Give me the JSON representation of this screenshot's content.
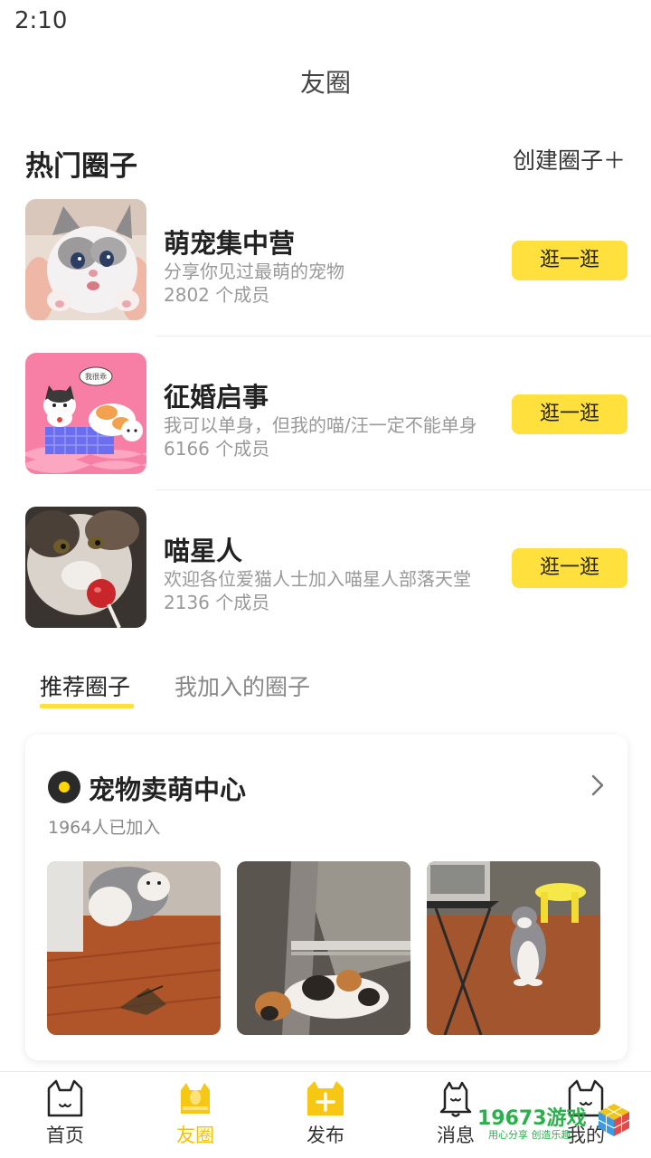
{
  "status": {
    "time": "2:10"
  },
  "header": {
    "title": "友圈"
  },
  "hot_section": {
    "title": "热门圈子",
    "create_label": "创建圈子＋"
  },
  "hot_circles": [
    {
      "name": "萌宠集中营",
      "desc": "分享你见过最萌的宠物",
      "members": "2802 个成员",
      "button": "逛一逛"
    },
    {
      "name": "征婚启事",
      "desc": "我可以单身，但我的喵/汪一定不能单身",
      "members": "6166 个成员",
      "button": "逛一逛",
      "thumb_text": "我很乖"
    },
    {
      "name": "喵星人",
      "desc": "欢迎各位爱猫人士加入喵星人部落天堂",
      "members": "2136 个成员",
      "button": "逛一逛"
    }
  ],
  "tabs": [
    {
      "label": "推荐圈子",
      "active": true
    },
    {
      "label": "我加入的圈子",
      "active": false
    }
  ],
  "recommended": {
    "title": "宠物卖萌中心",
    "joined": "1964人已加入",
    "photos": [
      "cat-playing-photo",
      "calico-cat-photo",
      "cat-sitting-photo"
    ]
  },
  "bottom_nav": [
    {
      "label": "首页",
      "icon": "home-cat-icon",
      "active": false
    },
    {
      "label": "友圈",
      "icon": "circle-cat-icon",
      "active": true
    },
    {
      "label": "发布",
      "icon": "publish-plus-icon",
      "active": false
    },
    {
      "label": "消息",
      "icon": "message-bell-icon",
      "active": false
    },
    {
      "label": "我的",
      "icon": "profile-cat-icon",
      "active": false
    }
  ],
  "watermark": {
    "text": "19673游戏",
    "subtext": "用心分享 创造乐趣"
  },
  "colors": {
    "accent": "#ffe03d",
    "nav_active": "#f3c10d",
    "muted": "#999999"
  }
}
